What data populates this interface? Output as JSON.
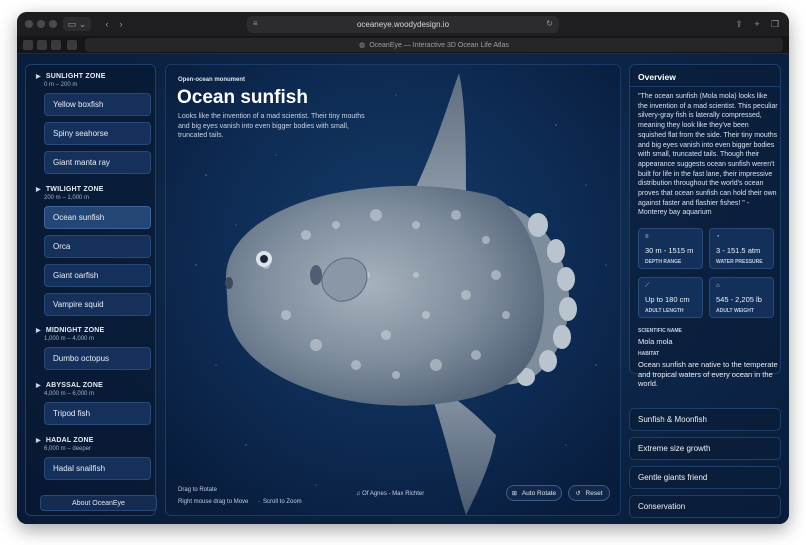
{
  "browser": {
    "url": "oceaneye.woodydesign.io",
    "tab_title": "OceanEye — Interactive 3D Ocean Life Atlas"
  },
  "sidebar": {
    "zones": [
      {
        "name": "SUNLIGHT ZONE",
        "range": "0 m – 200 m",
        "items": [
          "Yellow boxfish",
          "Spiny seahorse",
          "Giant manta ray"
        ]
      },
      {
        "name": "TWILIGHT ZONE",
        "range": "200 m – 1,000 m",
        "items": [
          "Ocean sunfish",
          "Orca",
          "Giant oarfish",
          "Vampire squid"
        ]
      },
      {
        "name": "MIDNIGHT ZONE",
        "range": "1,000 m – 4,000 m",
        "items": [
          "Dumbo octopus"
        ]
      },
      {
        "name": "ABYSSAL ZONE",
        "range": "4,000 m – 6,000 m",
        "items": [
          "Tripod fish"
        ]
      },
      {
        "name": "HADAL ZONE",
        "range": "6,000 m – deeper",
        "items": [
          "Hadal snailfish"
        ]
      }
    ],
    "active_item": "Ocean sunfish",
    "about_label": "About OceanEye"
  },
  "viewer": {
    "eyebrow": "Open-ocean monument",
    "title": "Ocean sunfish",
    "intro": "Looks like the invention of a mad scientist. Their tiny mouths and big eyes vanish into even bigger bodies with small, truncated tails.",
    "help_rotate": "Drag to Rotate",
    "help_move": "Right mouse drag to Move",
    "help_zoom": "Scroll to Zoom",
    "music": "Of Agnes - Max Richter",
    "auto_rotate_label": "Auto Rotate",
    "reset_label": "Reset"
  },
  "overview": {
    "title": "Overview",
    "quote": "\"The ocean sunfish (Mola mola) looks like the invention of a mad scientist. This peculiar silvery-gray fish is laterally compressed, meaning they look like they've been squished flat from the side. Their tiny mouths and big eyes vanish into even bigger bodies with small, truncated tails. Though their appearance suggests ocean sunfish weren't built for life in the fast lane, their impressive distribution throughout the world's ocean proves that ocean sunfish can hold their own against faster and flashier fishes! \" - Monterey bay aquarium",
    "stats": [
      {
        "icon": "depth-icon",
        "value": "30 m - 1515 m",
        "label": "DEPTH RANGE"
      },
      {
        "icon": "pressure-icon",
        "value": "3 - 151.5 atm",
        "label": "WATER PRESSURE"
      },
      {
        "icon": "length-icon",
        "value": "Up to 180 cm",
        "label": "ADULT LENGTH"
      },
      {
        "icon": "weight-icon",
        "value": "545 - 2,205 lb",
        "label": "ADULT WEIGHT"
      }
    ],
    "scientific_name_label": "SCIENTIFIC NAME",
    "scientific_name": "Mola mola",
    "habitat_label": "HABITAT",
    "habitat": "Ocean sunfish are native to the temperate and tropical waters of every ocean in the world."
  },
  "accordions": [
    "Sunfish & Moonfish",
    "Extreme size growth",
    "Gentle giants friend",
    "Conservation"
  ]
}
